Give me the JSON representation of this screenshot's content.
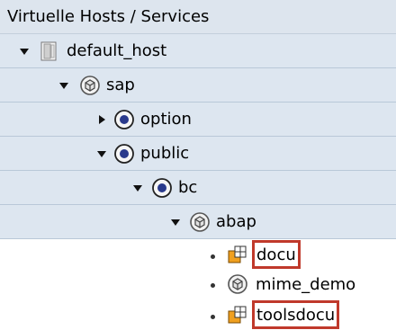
{
  "header": {
    "title": "Virtuelle Hosts / Services"
  },
  "tree": [
    {
      "label": "default_host",
      "icon": "server-host-icon",
      "expander": "expanded",
      "highlighted": false
    },
    {
      "label": "sap",
      "icon": "service-node-icon",
      "expander": "expanded",
      "highlighted": false
    },
    {
      "label": "option",
      "icon": "active-service-icon",
      "expander": "collapsed",
      "highlighted": false
    },
    {
      "label": "public",
      "icon": "active-service-icon",
      "expander": "expanded",
      "highlighted": false
    },
    {
      "label": "bc",
      "icon": "active-service-icon",
      "expander": "expanded",
      "highlighted": false
    },
    {
      "label": "abap",
      "icon": "service-node-icon",
      "expander": "expanded",
      "highlighted": false
    },
    {
      "label": "docu",
      "icon": "service-handler-icon",
      "expander": "leaf",
      "highlighted": true
    },
    {
      "label": "mime_demo",
      "icon": "service-node-icon",
      "expander": "leaf",
      "highlighted": false
    },
    {
      "label": "toolsdocu",
      "icon": "service-handler-icon",
      "expander": "leaf",
      "highlighted": true
    }
  ],
  "colors": {
    "highlight_border": "#c0392b",
    "row_bg": "#dde6f0",
    "header_bg": "#dde5ee"
  }
}
